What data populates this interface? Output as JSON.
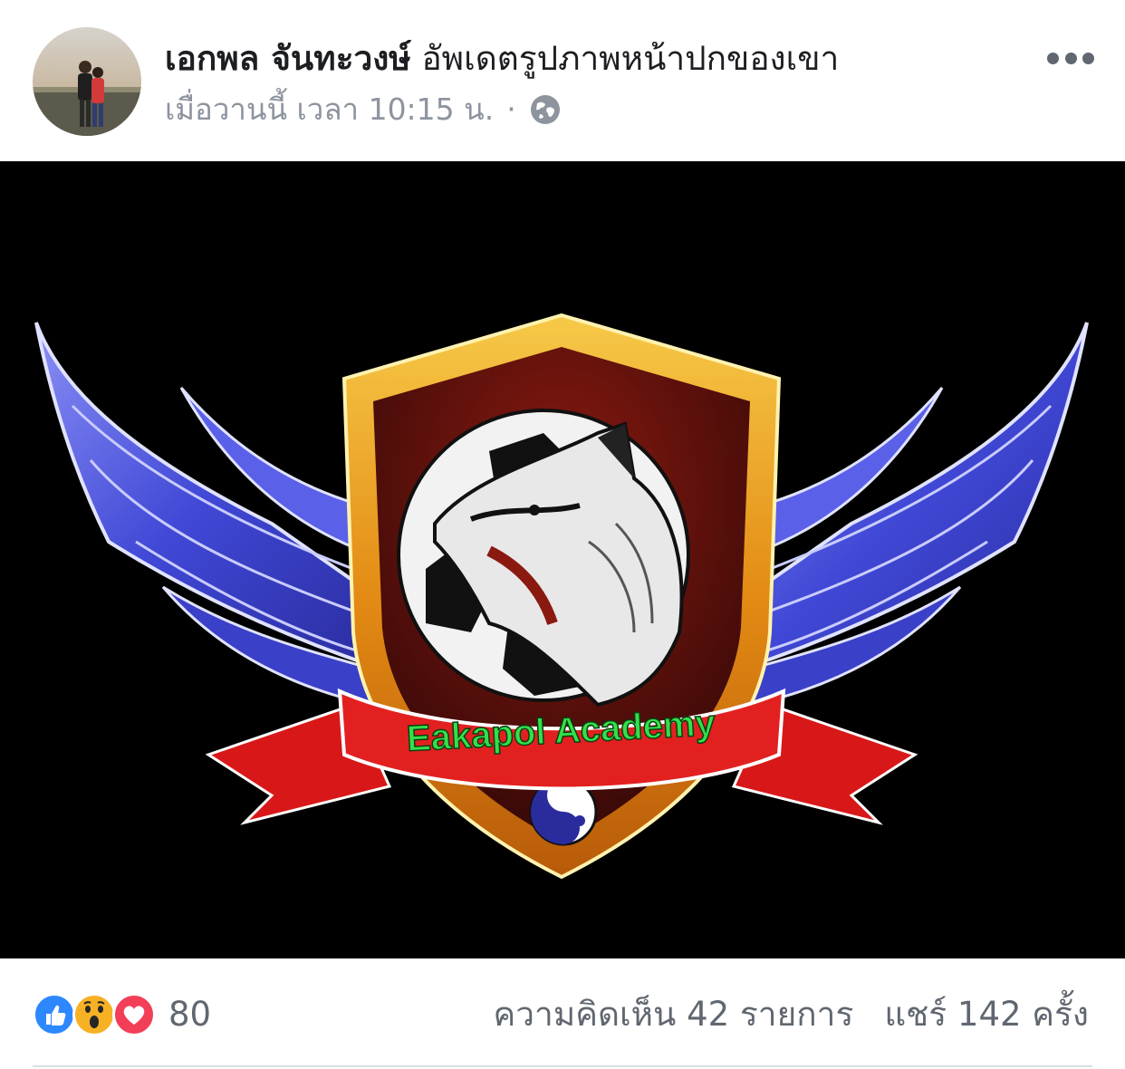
{
  "post": {
    "author_name": "เอกพล จันทะวงษ์",
    "action_text": "อัพเดตรูปภาพหน้าปกของเขา",
    "timestamp": "เมื่อวานนี้ เวลา 10:15 น.",
    "separator": "·",
    "privacy_icon": "globe-icon",
    "more_icon": "more-options-icon"
  },
  "cover": {
    "banner_text": "Eakapol Academy",
    "colors": {
      "background": "#000000",
      "wing": "#4a4fd8",
      "shield_outer": "#f0a020",
      "shield_inner": "#4a0d0d",
      "ribbon": "#e32020",
      "banner_text": "#33e04a"
    }
  },
  "footer": {
    "reactions": [
      "like-icon",
      "wow-icon",
      "love-icon"
    ],
    "reaction_count": "80",
    "comments": "ความคิดเห็น 42 รายการ",
    "shares": "แชร์ 142 ครั้ง"
  }
}
